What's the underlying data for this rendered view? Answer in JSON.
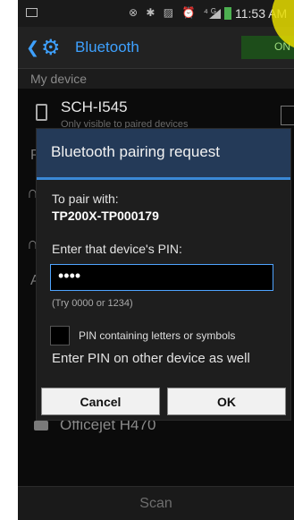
{
  "status_bar": {
    "clock": "11:53 AM",
    "icons": [
      "image-icon",
      "vibrate-icon",
      "bluetooth-icon",
      "nfc-icon",
      "alarm-icon",
      "4g-icon",
      "signal-icon",
      "battery-icon"
    ]
  },
  "header": {
    "title": "Bluetooth",
    "toggle_label": "ON"
  },
  "sections": {
    "my_device": "My device",
    "paired_letter": "P",
    "available_letter": "A"
  },
  "my_device": {
    "name": "SCH-I545",
    "subtitle": "Only visible to paired devices"
  },
  "background_device": {
    "name": "Officejet H470"
  },
  "scan_label": "Scan",
  "dialog": {
    "title": "Bluetooth pairing request",
    "pair_with_label": "To pair with:",
    "device_name": "TP200X-TP000179",
    "pin_prompt": "Enter that device's PIN:",
    "pin_value": "••••",
    "pin_hint": "(Try 0000 or 1234)",
    "checkbox_label": "PIN containing letters or symbols",
    "other_device_text": "Enter PIN on other device as well",
    "cancel_label": "Cancel",
    "ok_label": "OK"
  },
  "colors": {
    "accent": "#3ea1ff",
    "dialog_title_bg": "#243a58",
    "highlight": "#e6dc00"
  }
}
